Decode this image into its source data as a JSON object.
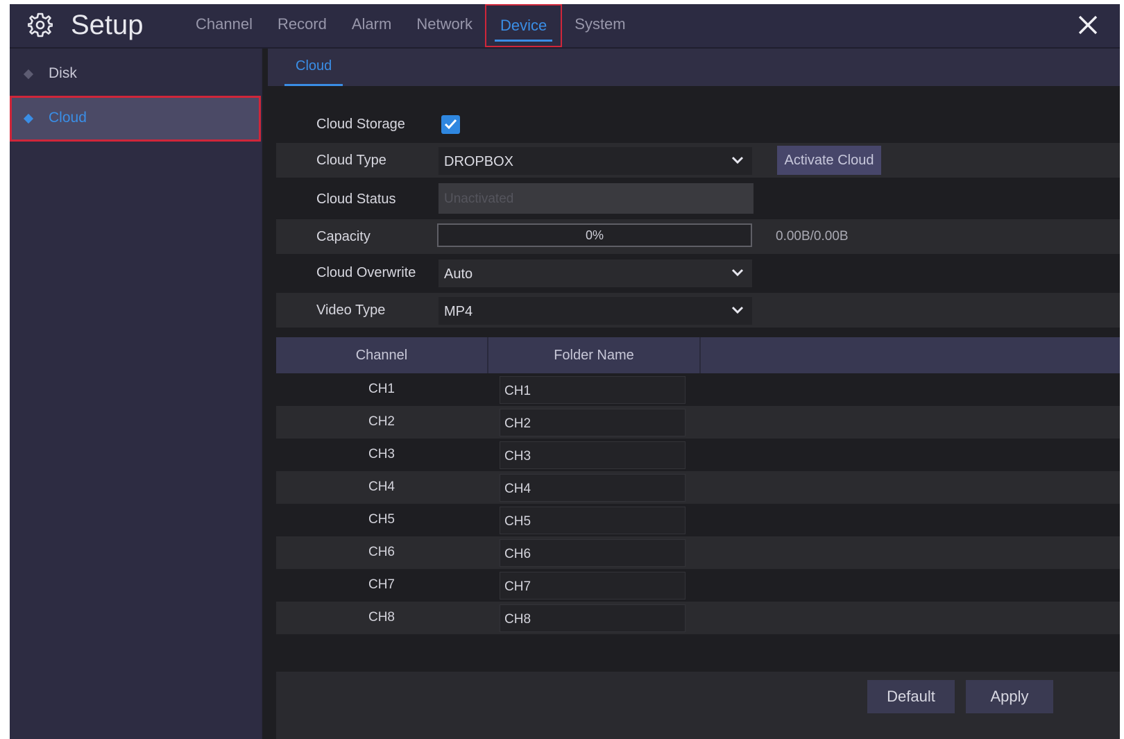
{
  "header": {
    "title": "Setup",
    "tabs": [
      {
        "label": "Channel"
      },
      {
        "label": "Record"
      },
      {
        "label": "Alarm"
      },
      {
        "label": "Network"
      },
      {
        "label": "Device"
      },
      {
        "label": "System"
      }
    ],
    "active_tab": "Device",
    "icons": {
      "settings": "gear-icon",
      "close": "close-icon"
    }
  },
  "sidebar": {
    "items": [
      {
        "label": "Disk"
      },
      {
        "label": "Cloud"
      }
    ],
    "active_item": "Cloud"
  },
  "subtabs": [
    {
      "label": "Cloud"
    }
  ],
  "form": {
    "cloud_storage": {
      "label": "Cloud Storage",
      "checked": true
    },
    "cloud_type": {
      "label": "Cloud Type",
      "value": "DROPBOX",
      "button": "Activate Cloud"
    },
    "cloud_status": {
      "label": "Cloud Status",
      "value": "Unactivated"
    },
    "capacity": {
      "label": "Capacity",
      "percent_text": "0%",
      "percent": 0,
      "usage": "0.00B/0.00B"
    },
    "cloud_overwrite": {
      "label": "Cloud Overwrite",
      "value": "Auto"
    },
    "video_type": {
      "label": "Video Type",
      "value": "MP4"
    }
  },
  "table": {
    "columns": [
      "Channel",
      "Folder Name",
      ""
    ],
    "rows": [
      {
        "channel": "CH1",
        "folder": "CH1"
      },
      {
        "channel": "CH2",
        "folder": "CH2"
      },
      {
        "channel": "CH3",
        "folder": "CH3"
      },
      {
        "channel": "CH4",
        "folder": "CH4"
      },
      {
        "channel": "CH5",
        "folder": "CH5"
      },
      {
        "channel": "CH6",
        "folder": "CH6"
      },
      {
        "channel": "CH7",
        "folder": "CH7"
      },
      {
        "channel": "CH8",
        "folder": "CH8"
      }
    ]
  },
  "footer": {
    "default_label": "Default",
    "apply_label": "Apply"
  },
  "colors": {
    "accent": "#3a8ee6",
    "highlight_outline": "#d0263a",
    "background": "#1e1e22",
    "panel": "#2b2a3f"
  }
}
